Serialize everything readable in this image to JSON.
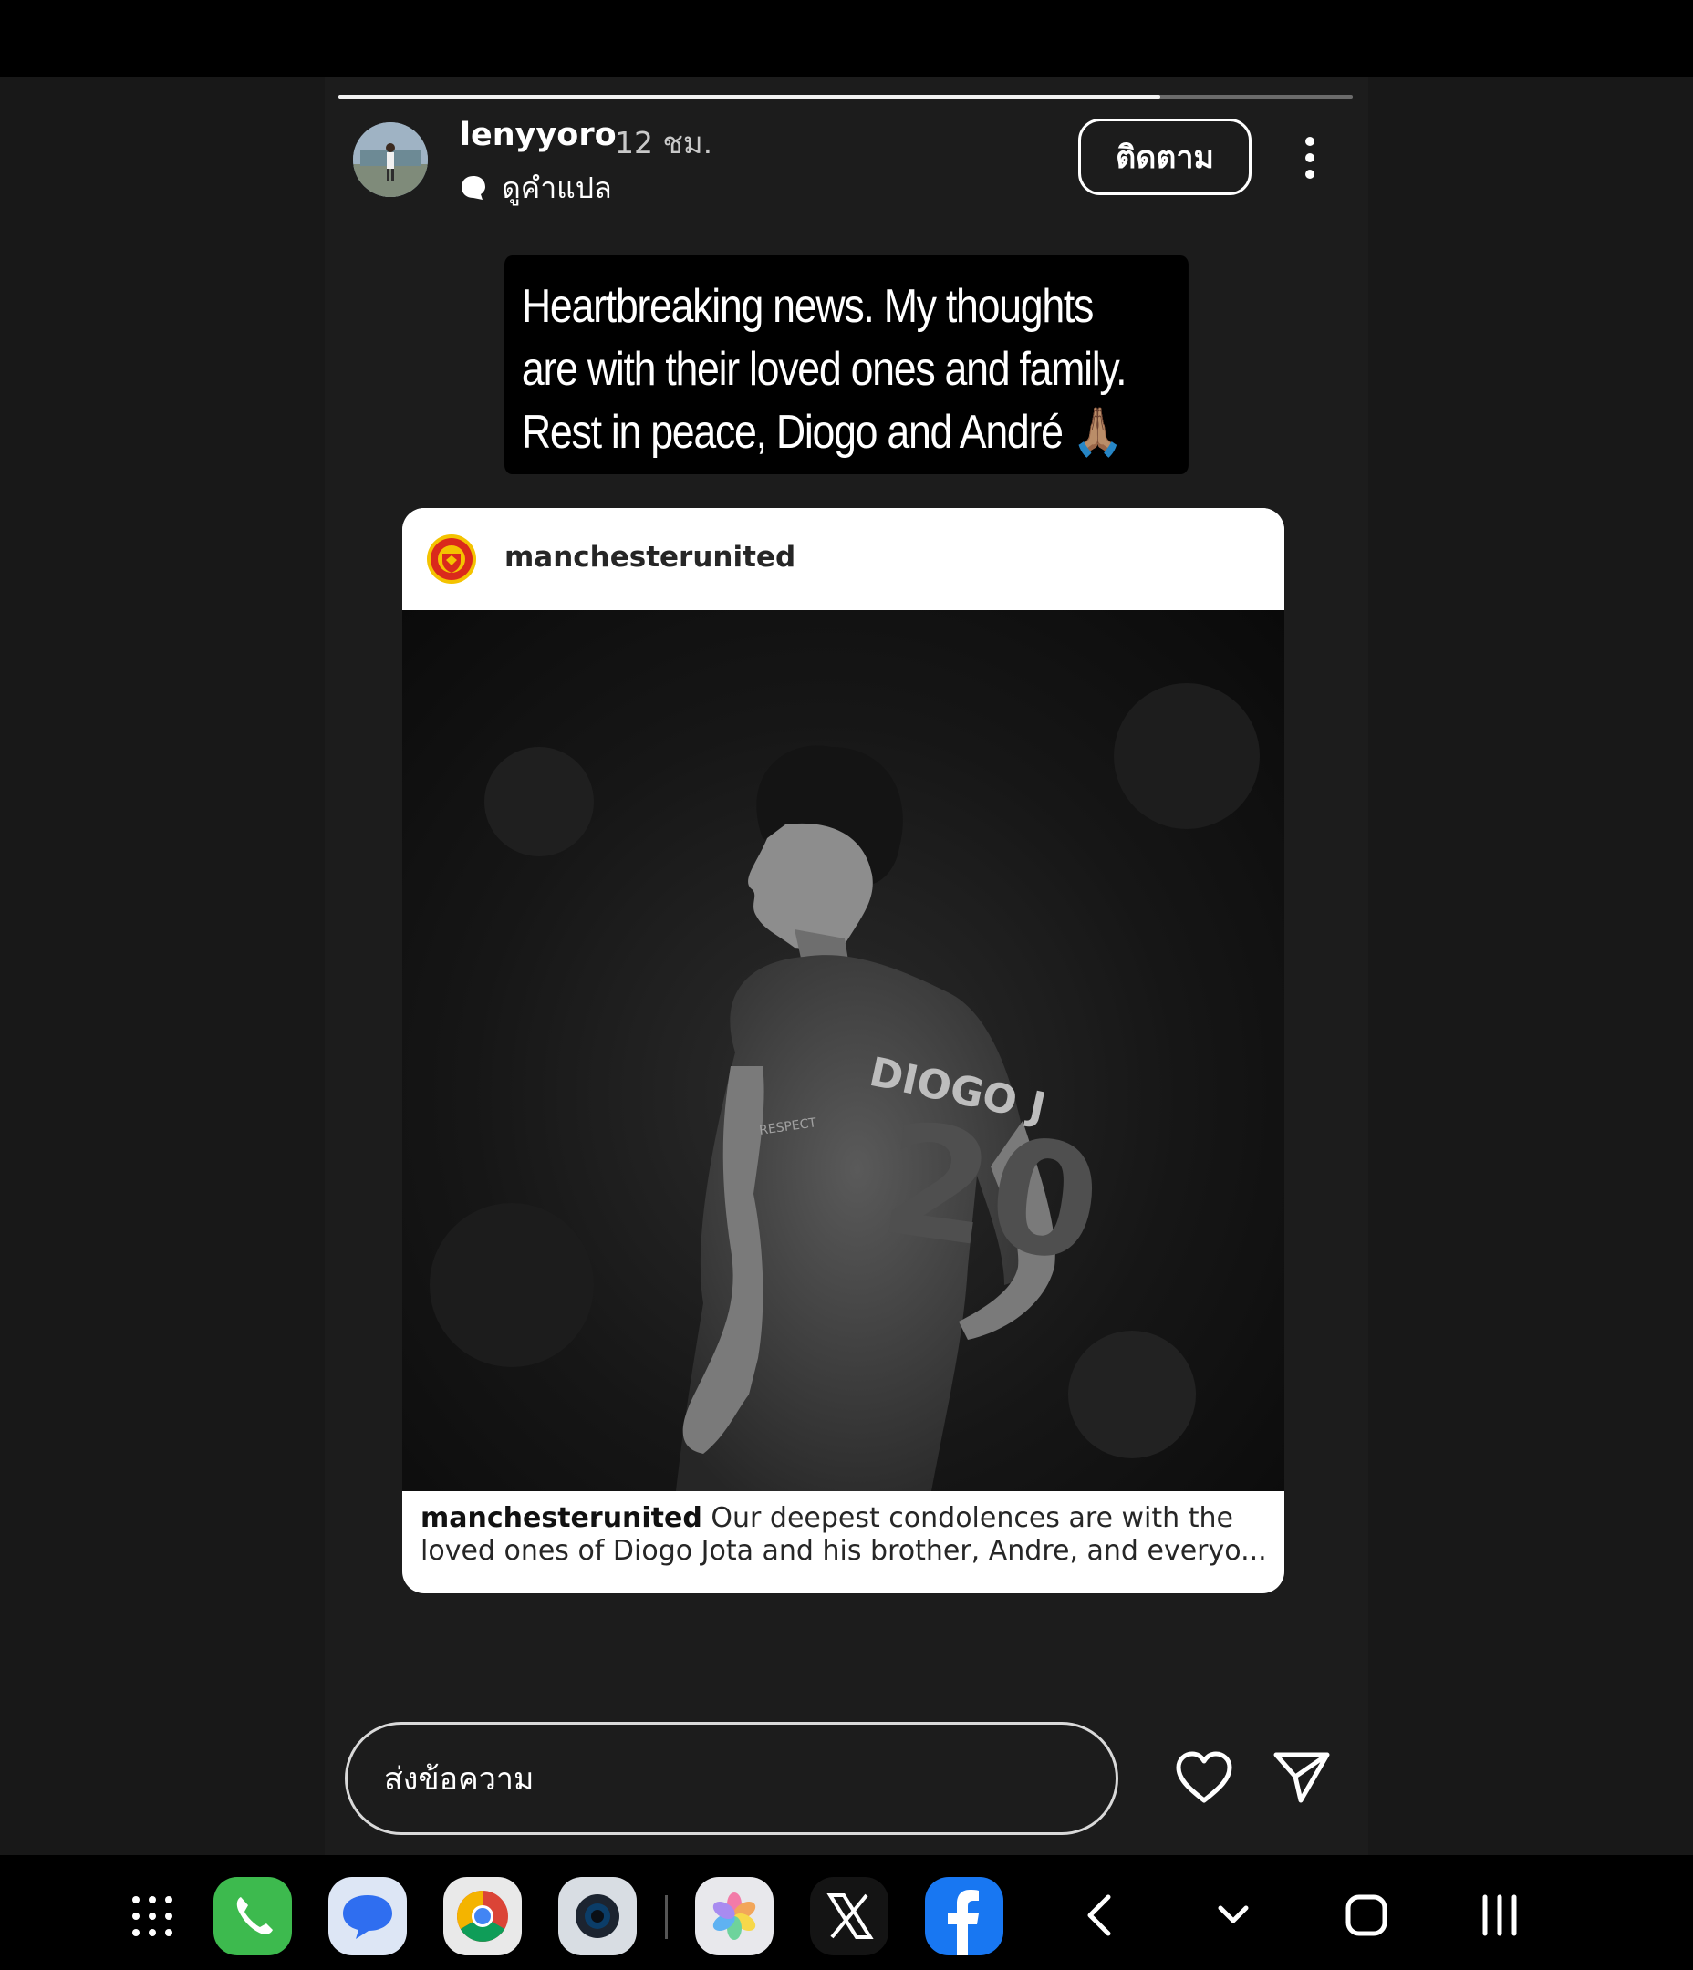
{
  "story": {
    "progress_fraction": 0.81,
    "username": "lenyyoro",
    "time_ago": "12 ชม.",
    "translate_label": "ดูคำแปล",
    "follow_label": "ติดตาม",
    "caption_lines": [
      "Heartbreaking news. My thoughts",
      "are with their loved ones and family.",
      "Rest in peace, Diogo and André 🙏🏽"
    ]
  },
  "shared_post": {
    "account": "manchesterunited",
    "caption_account": "manchesterunited",
    "caption_text": "Our deepest condolences are with the loved ones of Diogo Jota and his brother, Andre, and everyo...",
    "jersey_text": "DIOGO J",
    "jersey_number": "20",
    "sleeve_badge": "RESPECT"
  },
  "reply": {
    "placeholder": "ส่งข้อความ"
  },
  "icons": {
    "heart": "heart-icon",
    "send": "send-icon",
    "more": "more-vertical-icon",
    "translate": "speech-bubble-icon"
  },
  "taskbar": {
    "apps": [
      "app-drawer-icon",
      "phone-icon",
      "messages-icon",
      "chrome-icon",
      "camera-icon",
      "gallery-icon",
      "x-icon",
      "facebook-icon"
    ],
    "nav": [
      "back-icon",
      "hide-keyboard-icon",
      "home-icon",
      "recents-icon"
    ]
  },
  "colors": {
    "background": "#181818",
    "story_bg": "#1c1c1c",
    "card_bg": "#ffffff",
    "phone_green": "#3dba4e",
    "messages_blue": "#2f6ef0",
    "facebook_blue": "#1877f2",
    "mu_red": "#da291c"
  }
}
